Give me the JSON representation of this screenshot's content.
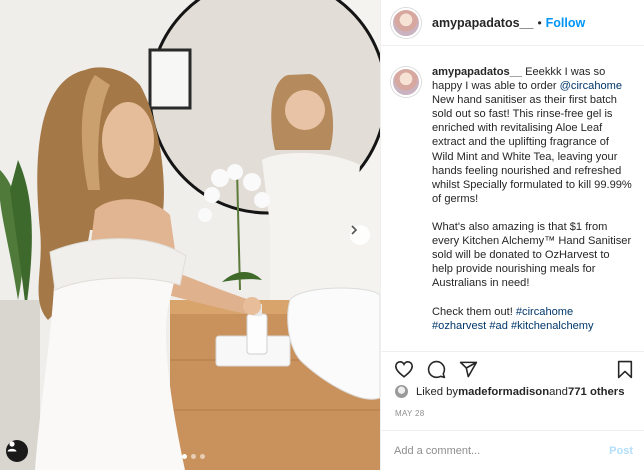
{
  "post": {
    "username": "amypapadatos__",
    "separator": "•",
    "follow_label": "Follow",
    "caption": {
      "username": "amypapadatos__",
      "p1_a": " Eeekkk I was so happy I was able to order ",
      "mention": "@circahome",
      "p1_b": " New hand sanitiser as their first batch sold out so fast! This rinse-free gel is enriched with revitalising Aloe Leaf extract and the uplifting fragrance of Wild Mint and White Tea, leaving your hands feeling nourished and refreshed whilst Specially formulated to kill 99.99% of germs!",
      "p2": "What's also amazing is that $1 from every Kitchen Alchemy™ Hand Sanitiser sold will be donated to OzHarvest to help provide nourishing meals for Australians in need!",
      "p3": "Check them out! ",
      "tag1": "#circahome",
      "tags": "#ozharvest #ad #kitchenalchemy"
    },
    "likes": {
      "prefix": "Liked by ",
      "by": "madeformadison",
      "middle": " and ",
      "count": "771 others"
    },
    "date": "MAY 28",
    "add_comment_placeholder": "Add a comment...",
    "post_label": "Post"
  },
  "icons": {
    "like": "heart-icon",
    "comment": "comment-icon",
    "share": "share-icon",
    "save": "bookmark-icon",
    "next": "chevron-right-icon",
    "tagged": "user-icon"
  },
  "colors": {
    "accent": "#0095f6",
    "text": "#262626",
    "muted": "#8e8e8e",
    "link": "#00376b"
  }
}
